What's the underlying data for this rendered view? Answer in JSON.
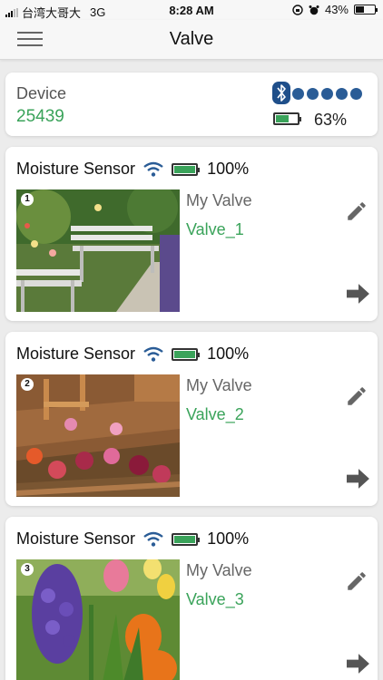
{
  "status_bar": {
    "carrier": "台湾大哥大",
    "network": "3G",
    "time": "8:28 AM",
    "battery": "43%",
    "battery_level": 0.43
  },
  "navbar": {
    "title": "Valve",
    "menu_icon": "hamburger-menu-icon"
  },
  "device": {
    "label": "Device",
    "id": "25439",
    "bluetooth_icon": "bluetooth-icon",
    "signal_dots": 5,
    "battery_pct": "63%",
    "battery_level": 0.63
  },
  "valves": [
    {
      "number": "1",
      "sensor": "Moisture Sensor",
      "sensor_battery": "100%",
      "name_label": "My Valve",
      "name": "Valve_1",
      "photo": "garden-bench"
    },
    {
      "number": "2",
      "sensor": "Moisture Sensor",
      "sensor_battery": "100%",
      "name_label": "My Valve",
      "name": "Valve_2",
      "photo": "flower-bed-deck"
    },
    {
      "number": "3",
      "sensor": "Moisture Sensor",
      "sensor_battery": "100%",
      "name_label": "My Valve",
      "name": "Valve_3",
      "photo": "hyacinth-tulips"
    }
  ],
  "colors": {
    "accent_green": "#3aa35a",
    "bluetooth_blue": "#1f4f8a",
    "wifi_blue": "#2a5c96"
  }
}
